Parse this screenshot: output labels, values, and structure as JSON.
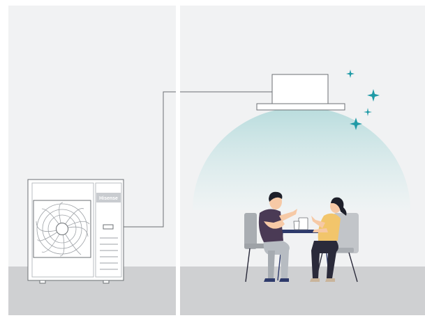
{
  "outdoor_unit": {
    "brand_label": "Hisense"
  },
  "colors": {
    "wall": "#f1f2f3",
    "floor": "#cfd0d2",
    "divider": "#ffffff",
    "unit_body": "#ffffff",
    "unit_outline": "#6b6f73",
    "fan_grille": "#b9bcc0",
    "brand_plate": "#c9ccd0",
    "cool_air_top": "#b8dcdd",
    "sparkle": "#1f9aa6",
    "chair": "#a9adb2",
    "table": "#2e3a6b",
    "man_shirt": "#4a3a55",
    "man_pants": "#b7bcc2",
    "woman_shirt": "#f2c56b",
    "woman_pants": "#2a2a3a",
    "skin": "#f6c9a6",
    "hair": "#1d1f2a"
  },
  "icons": {
    "outdoor": "outdoor-ac-unit-illustration",
    "indoor": "ceiling-cassette-ac-illustration",
    "sparkle": "sparkle-icon",
    "people": "people-at-table-illustration"
  }
}
